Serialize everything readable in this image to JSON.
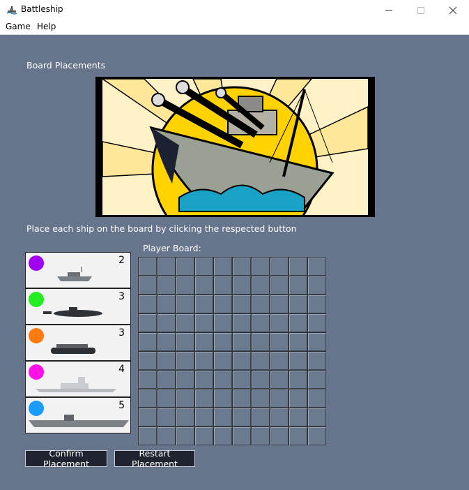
{
  "window": {
    "title": "Battleship"
  },
  "menu": {
    "items": [
      "Game",
      "Help"
    ]
  },
  "main": {
    "heading": "Board Placements",
    "instruction": "Place each ship on the board by clicking the respected button",
    "board_label": "Player Board:",
    "ships": [
      {
        "name": "patrol",
        "color": "#a000f0",
        "length": "2"
      },
      {
        "name": "submarine",
        "color": "#22ee22",
        "length": "3"
      },
      {
        "name": "destroyer",
        "color": "#ff7a10",
        "length": "3"
      },
      {
        "name": "battleship",
        "color": "#ff10e6",
        "length": "4"
      },
      {
        "name": "carrier",
        "color": "#1a9cff",
        "length": "5"
      }
    ],
    "grid": {
      "rows": 10,
      "cols": 10
    },
    "buttons": {
      "confirm": "Confirm Placement",
      "restart": "Restart Placement"
    }
  },
  "colors": {
    "background": "#66758c",
    "button": "#1f2430",
    "cell": "#6c7a8f"
  }
}
